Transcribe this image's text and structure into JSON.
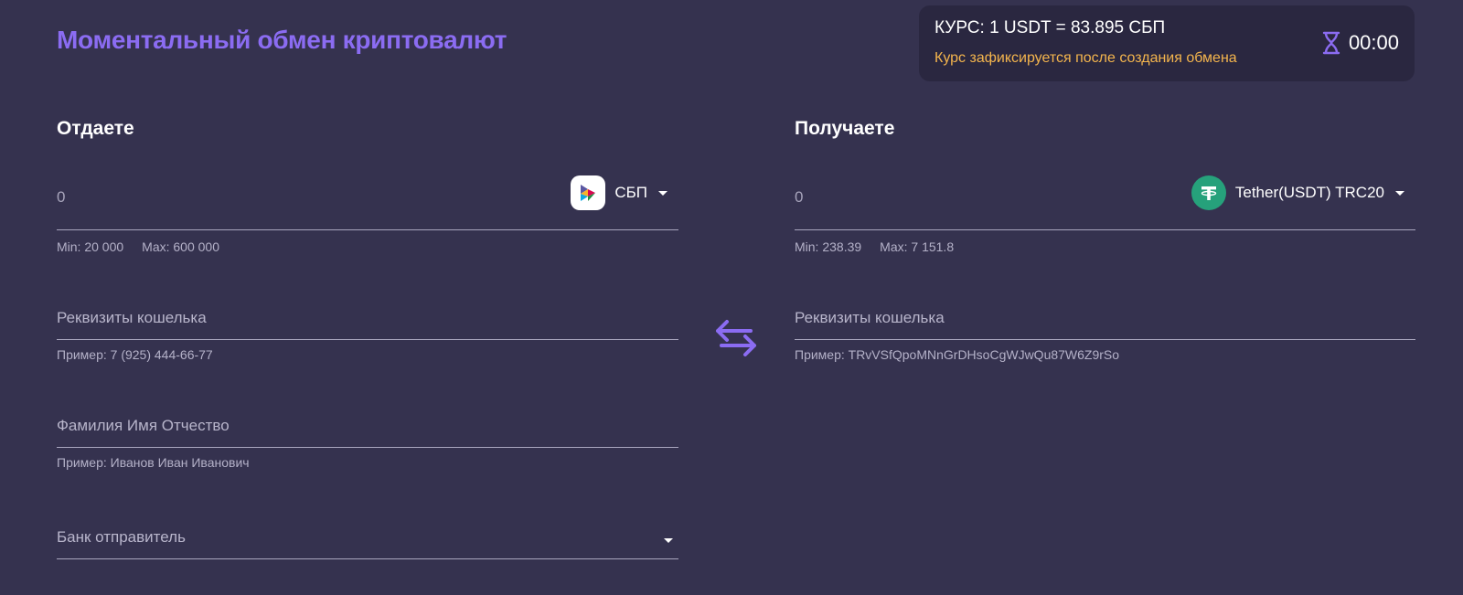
{
  "header": {
    "title": "Моментальный обмен криптовалют"
  },
  "rate": {
    "text": "КУРС: 1 USDT = 83.895 СБП",
    "note": "Курс зафиксируется после создания обмена",
    "timer": "00:00",
    "timer_icon": "hourglass-icon"
  },
  "colors": {
    "background": "#35324f",
    "accent": "#8b6cf2",
    "note": "#f4b54d",
    "panel": "#2a2740"
  },
  "give": {
    "heading": "Отдаете",
    "amount": "0",
    "currency": "СБП",
    "currency_icon": "sbp-icon",
    "min": "Min: 20 000",
    "max": "Max: 600 000",
    "wallet_placeholder": "Реквизиты кошелька",
    "wallet_hint": "Пример: 7 (925) 444-66-77",
    "name_placeholder": "Фамилия Имя Отчество",
    "name_hint": "Пример: Иванов Иван Иванович",
    "bank_placeholder": "Банк отправитель"
  },
  "receive": {
    "heading": "Получаете",
    "amount": "0",
    "currency": "Tether(USDT) TRC20",
    "currency_icon": "tether-icon",
    "min": "Min: 238.39",
    "max": "Max: 7 151.8",
    "wallet_placeholder": "Реквизиты кошелька",
    "wallet_hint": "Пример: TRvVSfQpoMNnGrDHsoCgWJwQu87W6Z9rSo"
  },
  "swap_icon": "swap-arrows-icon"
}
